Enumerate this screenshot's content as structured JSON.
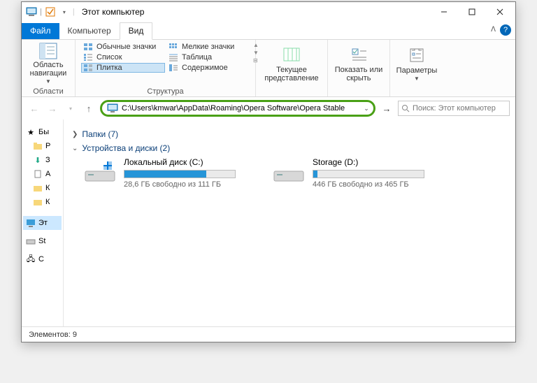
{
  "window": {
    "title": "Этот компьютер",
    "min": "—",
    "max": "▢",
    "close": "✕"
  },
  "tabs": {
    "file": "Файл",
    "computer": "Компьютер",
    "view": "Вид"
  },
  "ribbon": {
    "nav_area": "Область навигации",
    "nav_group": "Области",
    "opts": {
      "regular": "Обычные значки",
      "small": "Мелкие значки",
      "list": "Список",
      "table": "Таблица",
      "tile": "Плитка",
      "content": "Содержимое"
    },
    "struct_group": "Структура",
    "current_view": "Текущее представление",
    "show_hide": "Показать или скрыть",
    "params": "Параметры"
  },
  "address": {
    "path": "C:\\Users\\kmwar\\AppData\\Roaming\\Opera Software\\Opera Stable"
  },
  "search": {
    "placeholder": "Поиск: Этот компьютер"
  },
  "sidebar": {
    "items": [
      "Бы",
      "Р",
      "З",
      "А",
      "К",
      "К",
      "Эт",
      "St",
      "C"
    ]
  },
  "main": {
    "folders_hdr": "Папки (7)",
    "devices_hdr": "Устройства и диски (2)",
    "drives": [
      {
        "name": "Локальный диск (C:)",
        "free": "28,6 ГБ свободно из 111 ГБ",
        "fill_pct": 74
      },
      {
        "name": "Storage (D:)",
        "free": "446 ГБ свободно из 465 ГБ",
        "fill_pct": 4
      }
    ]
  },
  "status": {
    "text": "Элементов: 9"
  }
}
